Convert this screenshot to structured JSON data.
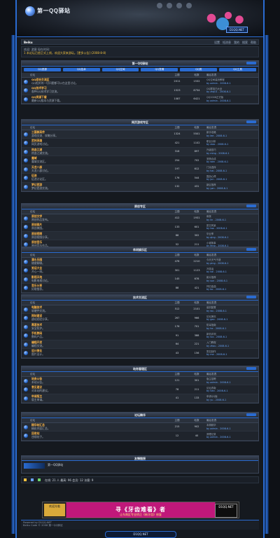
{
  "header": {
    "site_name": "第一QQ驿站",
    "badge": "D1QQ.NET"
  },
  "userbar": {
    "brand": "Beiku",
    "links": [
      "设置",
      "短消息",
      "我的",
      "搜索",
      "帮助"
    ]
  },
  "infobar": {
    "line1": "欢迎: 游客  现在时间:",
    "line2": "1 本论坛已经正式上线，欢迎大家来游玩。[更多公告] (2008-8-8)"
  },
  "columns": {
    "forum": "论坛",
    "topics": "主题",
    "posts": "帖数",
    "last": "最后发表"
  },
  "sections": [
    {
      "title": "第一QQ驿站",
      "tabs": [
        "QQ资源",
        "QQ技术",
        "QQ空间",
        "QQ表情",
        "QQ秀",
        "QQ工具"
      ],
      "rows": [
        {
          "name": "QQ综合交流区",
          "desc": "QQ相关的一切问题都可以在这里讨论。",
          "topics": "2011",
          "posts": "1532",
          "last": "QQ空间装扮教程",
          "by": "by admin - 2008-6-1"
        },
        {
          "name": "QQ技术学习",
          "desc": "各种QQ技术学习交流。",
          "topics": "1523",
          "posts": "8734",
          "last": "QQ群技巧大全",
          "by": "by zhq01 - 2008-6-1"
        },
        {
          "name": "QQ资源下载",
          "desc": "最新QQ版本与资源下载。",
          "topics": "1087",
          "posts": "6421",
          "last": "QQ2008正式版",
          "by": "by admin - 2008-6-1"
        }
      ]
    },
    {
      "title": "网页游戏专区",
      "rows": [
        {
          "name": "三国群英传",
          "desc": "游戏交流、攻略分享。",
          "topics": "1324",
          "posts": "5501",
          "last": "新手攻略",
          "by": "by lee - 2008-6-1"
        },
        {
          "name": "武林英雄",
          "desc": "网页游戏讨论。",
          "topics": "421",
          "posts": "1102",
          "last": "职业分析",
          "by": "by xiao - 2008-6-1"
        },
        {
          "name": "热血江湖",
          "desc": "热血江湖交流。",
          "topics": "318",
          "posts": "897",
          "last": "升级技巧",
          "by": "by ming - 2008-6-1"
        },
        {
          "name": "魔域",
          "desc": "魔域交流区。",
          "topics": "254",
          "posts": "702",
          "last": "宠物合成",
          "by": "by wen - 2008-6-1"
        },
        {
          "name": "天龙八部",
          "desc": "天龙八部讨论。",
          "topics": "197",
          "posts": "612",
          "last": "门派选择",
          "by": "by hai - 2008-6-1"
        },
        {
          "name": "征途",
          "desc": "征途讨论区。",
          "topics": "176",
          "posts": "544",
          "last": "国战心得",
          "by": "by jun - 2008-6-1"
        },
        {
          "name": "梦幻西游",
          "desc": "梦幻西游交流。",
          "topics": "132",
          "posts": "431",
          "last": "新区推荐",
          "by": "by yan - 2008-6-1"
        }
      ]
    },
    {
      "title": "原创专区",
      "rows": [
        {
          "name": "原创文学",
          "desc": "原创作品发布。",
          "topics": "412",
          "posts": "1931",
          "last": "雨夜",
          "by": "by lin - 2008-6-1"
        },
        {
          "name": "原创图片",
          "desc": "原创美图。",
          "topics": "133",
          "posts": "601",
          "last": "夏日风景",
          "by": "by tao - 2008-6-1"
        },
        {
          "name": "原创视频",
          "desc": "原创视频分享。",
          "topics": "88",
          "posts": "302",
          "last": "毕业季",
          "by": "by qing - 2008-6-1"
        },
        {
          "name": "原创音乐",
          "desc": "原创音乐作品。",
          "topics": "52",
          "posts": "211",
          "last": "小城故事",
          "by": "by feng - 2008-6-1"
        }
      ]
    },
    {
      "title": "休闲娱乐区",
      "rows": [
        {
          "name": "灌水乐园",
          "desc": "随便聊聊。",
          "topics": "478",
          "posts": "2210",
          "last": "今天天气不错",
          "by": "by ping - 2008-6-1"
        },
        {
          "name": "笑话大全",
          "desc": "开心一刻。",
          "topics": "301",
          "posts": "1123",
          "last": "冷笑话",
          "by": "by kai - 2008-6-1"
        },
        {
          "name": "影视天地",
          "desc": "电影电视讨论。",
          "topics": "145",
          "posts": "678",
          "last": "新片推荐",
          "by": "by sun - 2008-6-1"
        },
        {
          "name": "音乐分享",
          "desc": "好歌推荐。",
          "topics": "88",
          "posts": "421",
          "last": "怀旧金曲",
          "by": "by bo - 2008-6-1"
        }
      ]
    },
    {
      "title": "技术交流区",
      "rows": [
        {
          "name": "电脑技术",
          "desc": "软硬件交流。",
          "topics": "512",
          "posts": "2101",
          "last": "装机配置",
          "by": "by wu - 2008-6-1"
        },
        {
          "name": "网站建设",
          "desc": "建站经验分享。",
          "topics": "267",
          "posts": "966",
          "last": "论坛美化",
          "by": "by gao - 2008-6-1"
        },
        {
          "name": "黑客技术",
          "desc": "安全防护。",
          "topics": "176",
          "posts": "701",
          "last": "防毒指南",
          "by": "by he - 2008-6-1"
        },
        {
          "name": "手机数码",
          "desc": "数码产品。",
          "topics": "91",
          "posts": "388",
          "last": "新机评测",
          "by": "by luo - 2008-6-1"
        },
        {
          "name": "编程开发",
          "desc": "编程交流。",
          "topics": "64",
          "posts": "221",
          "last": "入门教程",
          "by": "by zhou - 2008-6-1"
        },
        {
          "name": "设计美化",
          "desc": "图片设计。",
          "topics": "43",
          "posts": "156",
          "last": "签名制作",
          "by": "by ma - 2008-6-1"
        }
      ]
    },
    {
      "title": "站务管理区",
      "rows": [
        {
          "name": "站务公告",
          "desc": "本站公告。",
          "topics": "121",
          "posts": "301",
          "last": "版主招聘",
          "by": "by admin - 2008-6-1"
        },
        {
          "name": "意见建议",
          "desc": "对本站的建议。",
          "topics": "78",
          "posts": "211",
          "last": "论坛改版",
          "by": "by tian - 2008-6-1"
        },
        {
          "name": "申请版主",
          "desc": "版主申请。",
          "topics": "41",
          "posts": "133",
          "last": "申请QQ版",
          "by": "by yu - 2008-6-1"
        }
      ]
    },
    {
      "title": "论坛精华",
      "rows": [
        {
          "name": "精华帖汇总",
          "desc": "精彩内容汇总。",
          "topics": "215",
          "posts": "902",
          "last": "本周精华",
          "by": "by admin - 2008-6-1"
        },
        {
          "name": "回收站",
          "desc": "违规帖子。",
          "topics": "12",
          "posts": "40",
          "last": "清理记录",
          "by": "by admin - 2008-6-1"
        }
      ]
    }
  ],
  "friendlinks": {
    "title": "友情链接",
    "text": "第一QQ驿站"
  },
  "stats": {
    "text": "在线: 21 人  最高: 96  会员: 12 访客: 9"
  },
  "banner": {
    "title": "寻《牙齿难看》者",
    "sub": "让东南区专业矫正《新牙齿》修复",
    "left": "欢迎光临",
    "right": "D1QQ.NET"
  },
  "footer": {
    "line1": "Powered by D1QQ.NET",
    "line2": "Beiku Code © 2008 第一QQ驿站",
    "pill": "D1QQ.NET"
  }
}
